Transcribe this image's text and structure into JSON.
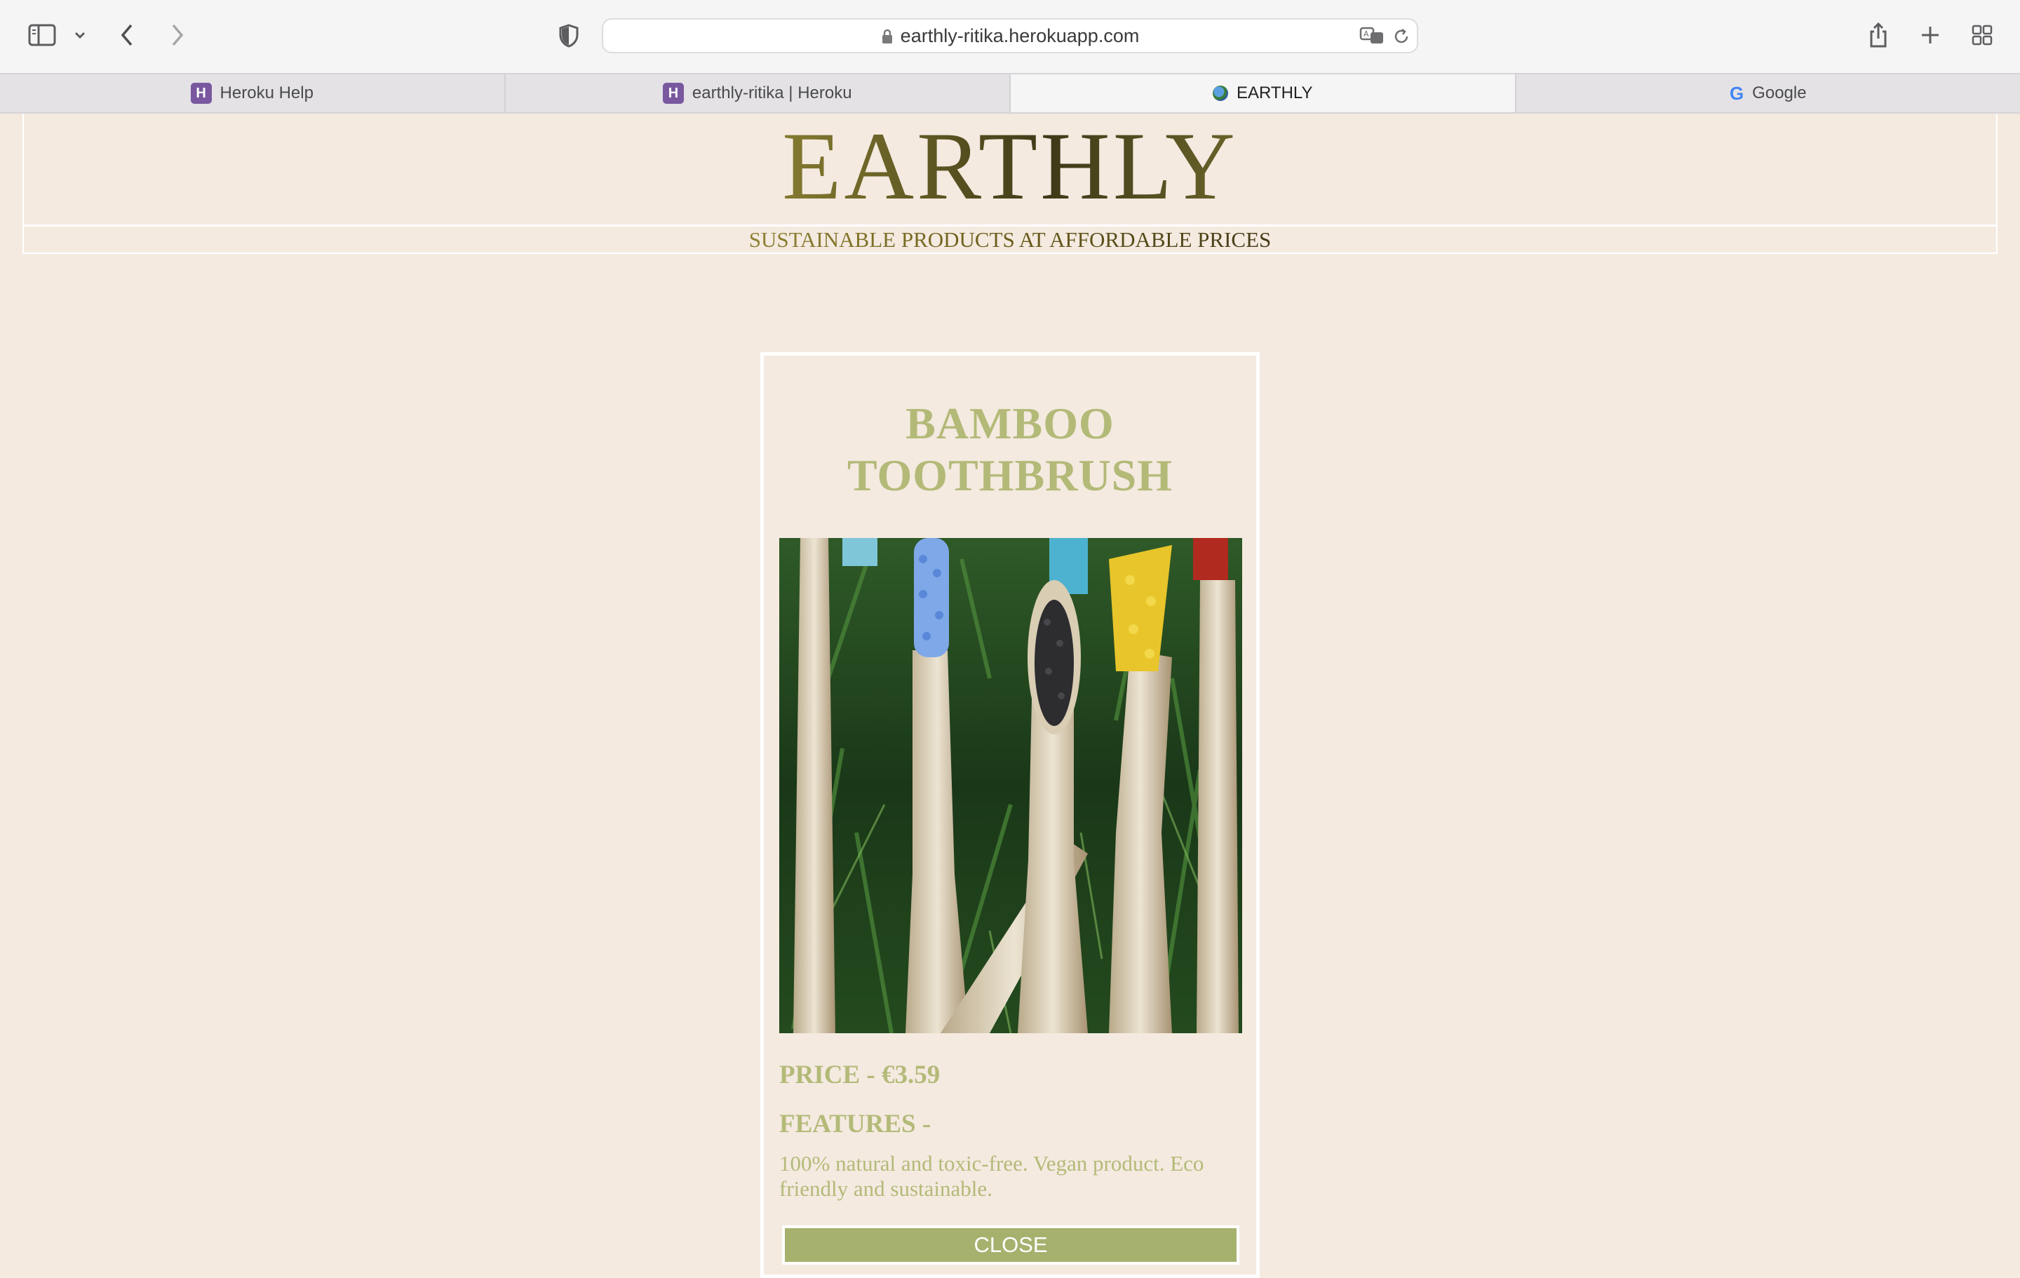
{
  "browser": {
    "url": "earthly-ritika.herokuapp.com",
    "tabs": [
      {
        "label": "Heroku Help",
        "favicon": "heroku-icon"
      },
      {
        "label": "earthly-ritika | Heroku",
        "favicon": "heroku-icon"
      },
      {
        "label": "EARTHLY",
        "favicon": "earth-icon",
        "active": true
      },
      {
        "label": "Google",
        "favicon": "google-icon"
      }
    ]
  },
  "header": {
    "brand": "EARTHLY",
    "tagline": "SUSTAINABLE PRODUCTS AT AFFORDABLE PRICES"
  },
  "product": {
    "title_line1": "BAMBOO",
    "title_line2": "TOOTHBRUSH",
    "price": "PRICE - €3.59",
    "features_heading": "FEATURES -",
    "description": "100% natural and toxic-free. Vegan product. Eco friendly and sustainable.",
    "close_label": "CLOSE"
  },
  "colors": {
    "page_bg": "#f4eae0",
    "accent_green": "#b3ba78",
    "button_green": "#a6b16e"
  }
}
